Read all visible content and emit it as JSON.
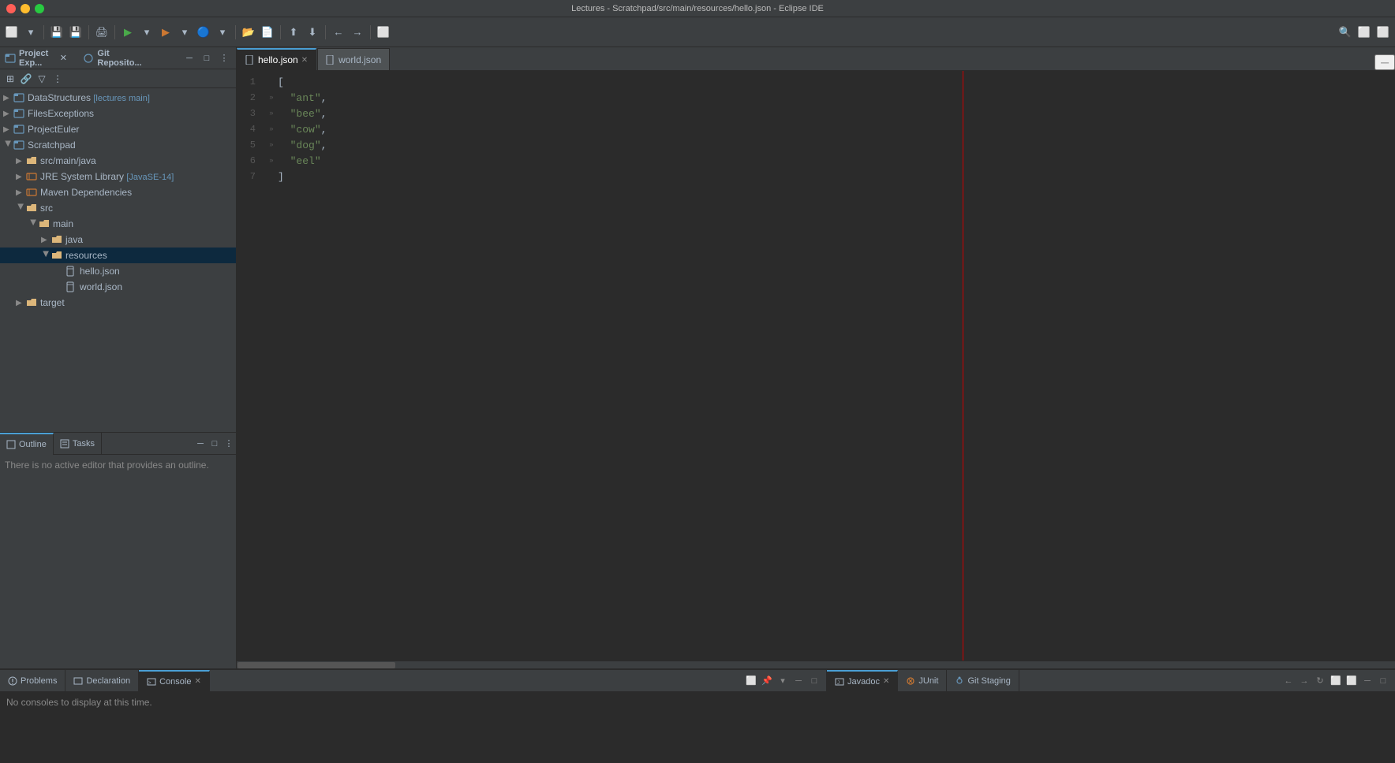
{
  "titleBar": {
    "title": "Lectures - Scratchpad/src/main/resources/hello.json - Eclipse IDE"
  },
  "toolbar": {
    "buttons": [
      "⬜",
      "▶",
      "⬛",
      "⬜",
      "⬜",
      "⬜",
      "⬜",
      "⬜",
      "⬜",
      "⬜"
    ]
  },
  "projectExplorer": {
    "title": "Project Exp...",
    "tab2": "Git Reposito...",
    "items": [
      {
        "id": "datastruct",
        "label": "DataStructures",
        "badge": "[lectures main]",
        "indent": 0,
        "type": "project",
        "expanded": true
      },
      {
        "id": "filesexc",
        "label": "FilesExceptions",
        "indent": 0,
        "type": "project",
        "expanded": false
      },
      {
        "id": "projecteuler",
        "label": "ProjectEuler",
        "indent": 0,
        "type": "project",
        "expanded": false
      },
      {
        "id": "scratchpad",
        "label": "Scratchpad",
        "indent": 0,
        "type": "project",
        "expanded": true
      },
      {
        "id": "src-main-java",
        "label": "src/main/java",
        "indent": 1,
        "type": "folder",
        "expanded": false
      },
      {
        "id": "jre",
        "label": "JRE System Library",
        "badge": "[JavaSE-14]",
        "indent": 1,
        "type": "lib",
        "expanded": false
      },
      {
        "id": "maven",
        "label": "Maven Dependencies",
        "indent": 1,
        "type": "lib",
        "expanded": false
      },
      {
        "id": "src",
        "label": "src",
        "indent": 1,
        "type": "folder",
        "expanded": true
      },
      {
        "id": "main",
        "label": "main",
        "indent": 2,
        "type": "folder",
        "expanded": true
      },
      {
        "id": "java",
        "label": "java",
        "indent": 3,
        "type": "folder",
        "expanded": false
      },
      {
        "id": "resources",
        "label": "resources",
        "indent": 3,
        "type": "folder",
        "expanded": true,
        "selected": true
      },
      {
        "id": "hello-json",
        "label": "hello.json",
        "indent": 4,
        "type": "file"
      },
      {
        "id": "world-json",
        "label": "world.json",
        "indent": 4,
        "type": "file"
      },
      {
        "id": "target",
        "label": "target",
        "indent": 1,
        "type": "folder",
        "expanded": false
      }
    ]
  },
  "outlinePanel": {
    "tabs": [
      {
        "label": "Outline",
        "icon": "outline"
      },
      {
        "label": "Tasks",
        "icon": "tasks"
      }
    ],
    "message": "There is no active editor that provides an outline."
  },
  "editorTabs": [
    {
      "label": "hello.json",
      "active": true
    },
    {
      "label": "world.json",
      "active": false
    }
  ],
  "codeEditor": {
    "lines": [
      {
        "num": 1,
        "dot": "",
        "content": "["
      },
      {
        "num": 2,
        "dot": "»",
        "content": "  \"ant\","
      },
      {
        "num": 3,
        "dot": "»",
        "content": "  \"bee\","
      },
      {
        "num": 4,
        "dot": "»",
        "content": "  \"cow\","
      },
      {
        "num": 5,
        "dot": "»",
        "content": "  \"dog\","
      },
      {
        "num": 6,
        "dot": "»",
        "content": "  \"eel\""
      },
      {
        "num": 7,
        "dot": "",
        "content": "]"
      }
    ]
  },
  "bottomPanel": {
    "leftTabs": [
      {
        "label": "Problems",
        "icon": "problems"
      },
      {
        "label": "Declaration",
        "icon": "declaration",
        "active": false
      },
      {
        "label": "Console",
        "icon": "console",
        "active": true
      }
    ],
    "rightTabs": [
      {
        "label": "Javadoc",
        "icon": "javadoc",
        "active": true
      },
      {
        "label": "JUnit",
        "icon": "junit"
      },
      {
        "label": "Git Staging",
        "icon": "git"
      }
    ],
    "consoleMessage": "No consoles to display at this time.",
    "rightContent": ""
  }
}
